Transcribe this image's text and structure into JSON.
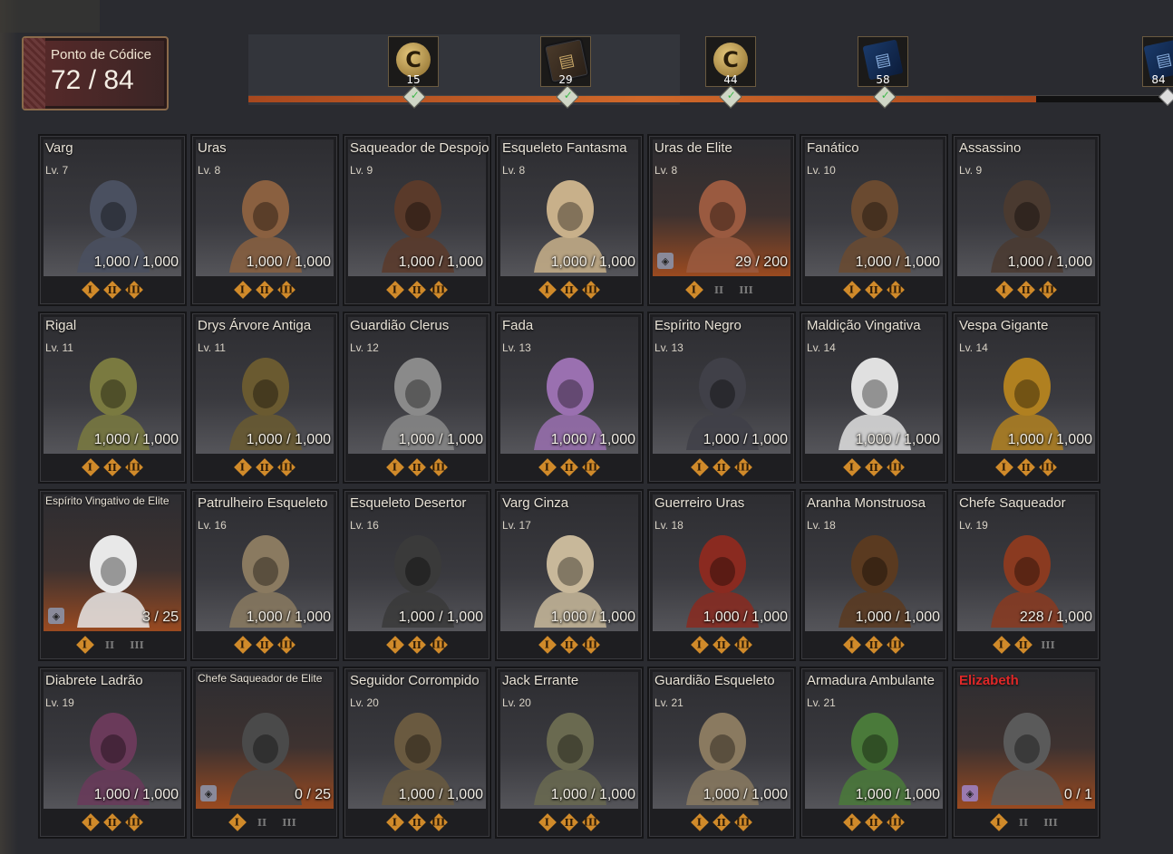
{
  "header": {
    "counter_label": "Ponto de Códice",
    "counter_value": "72 / 84",
    "progress_fraction": 0.86,
    "rewards": [
      {
        "icon": "coin-icon",
        "qty": "15"
      },
      {
        "icon": "card-icon",
        "qty": "29"
      },
      {
        "icon": "coin-icon",
        "qty": "44"
      },
      {
        "icon": "card-blue-icon",
        "qty": "58"
      },
      {
        "icon": "card-blue-icon",
        "qty": "84"
      }
    ]
  },
  "monsters": [
    {
      "name": "Varg",
      "level": "Lv. 7",
      "count": "1,000 / 1,000",
      "tiers": [
        1,
        1,
        1
      ]
    },
    {
      "name": "Uras",
      "level": "Lv. 8",
      "count": "1,000 / 1,000",
      "tiers": [
        1,
        1,
        1
      ]
    },
    {
      "name": "Saqueador de Despojos",
      "level": "Lv. 9",
      "count": "1,000 / 1,000",
      "tiers": [
        1,
        1,
        1
      ]
    },
    {
      "name": "Esqueleto Fantasma",
      "level": "Lv. 8",
      "count": "1,000 / 1,000",
      "tiers": [
        1,
        1,
        1
      ]
    },
    {
      "name": "Uras de Elite",
      "level": "Lv. 8",
      "count": "29 / 200",
      "tiers": [
        1,
        0,
        0
      ],
      "elite": true
    },
    {
      "name": "Fanático",
      "level": "Lv. 10",
      "count": "1,000 / 1,000",
      "tiers": [
        1,
        1,
        1
      ]
    },
    {
      "name": "Assassino",
      "level": "Lv. 9",
      "count": "1,000 / 1,000",
      "tiers": [
        1,
        1,
        1
      ]
    },
    {
      "name": "Rigal",
      "level": "Lv. 11",
      "count": "1,000 / 1,000",
      "tiers": [
        1,
        1,
        1
      ]
    },
    {
      "name": "Drys Árvore Antiga",
      "level": "Lv. 11",
      "count": "1,000 / 1,000",
      "tiers": [
        1,
        1,
        1
      ]
    },
    {
      "name": "Guardião Clerus",
      "level": "Lv. 12",
      "count": "1,000 / 1,000",
      "tiers": [
        1,
        1,
        1
      ]
    },
    {
      "name": "Fada",
      "level": "Lv. 13",
      "count": "1,000 / 1,000",
      "tiers": [
        1,
        1,
        1
      ]
    },
    {
      "name": "Espírito Negro",
      "level": "Lv. 13",
      "count": "1,000 / 1,000",
      "tiers": [
        1,
        1,
        1
      ]
    },
    {
      "name": "Maldição Vingativa",
      "level": "Lv. 14",
      "count": "1,000 / 1,000",
      "tiers": [
        1,
        1,
        1
      ]
    },
    {
      "name": "Vespa Gigante",
      "level": "Lv. 14",
      "count": "1,000 / 1,000",
      "tiers": [
        1,
        1,
        1
      ]
    },
    {
      "name": "Espírito Vingativo de Elite",
      "level": "",
      "count": "3 / 25",
      "tiers": [
        1,
        0,
        0
      ],
      "elite": true,
      "small": true
    },
    {
      "name": "Patrulheiro Esqueleto",
      "level": "Lv. 16",
      "count": "1,000 / 1,000",
      "tiers": [
        1,
        1,
        1
      ]
    },
    {
      "name": "Esqueleto Desertor",
      "level": "Lv. 16",
      "count": "1,000 / 1,000",
      "tiers": [
        1,
        1,
        1
      ]
    },
    {
      "name": "Varg Cinza",
      "level": "Lv. 17",
      "count": "1,000 / 1,000",
      "tiers": [
        1,
        1,
        1
      ]
    },
    {
      "name": "Guerreiro Uras",
      "level": "Lv. 18",
      "count": "1,000 / 1,000",
      "tiers": [
        1,
        1,
        1
      ]
    },
    {
      "name": "Aranha Monstruosa",
      "level": "Lv. 18",
      "count": "1,000 / 1,000",
      "tiers": [
        1,
        1,
        1
      ]
    },
    {
      "name": "Chefe Saqueador",
      "level": "Lv. 19",
      "count": "228 / 1,000",
      "tiers": [
        1,
        1,
        0
      ]
    },
    {
      "name": "Diabrete Ladrão",
      "level": "Lv. 19",
      "count": "1,000 / 1,000",
      "tiers": [
        1,
        1,
        1
      ]
    },
    {
      "name": "Chefe Saqueador de Elite",
      "level": "",
      "count": "0 / 25",
      "tiers": [
        1,
        0,
        0
      ],
      "elite": true,
      "small": true
    },
    {
      "name": "Seguidor Corrompido",
      "level": "Lv. 20",
      "count": "1,000 / 1,000",
      "tiers": [
        1,
        1,
        1
      ]
    },
    {
      "name": "Jack Errante",
      "level": "Lv. 20",
      "count": "1,000 / 1,000",
      "tiers": [
        1,
        1,
        1
      ]
    },
    {
      "name": "Guardião Esqueleto",
      "level": "Lv. 21",
      "count": "1,000 / 1,000",
      "tiers": [
        1,
        1,
        1
      ]
    },
    {
      "name": "Armadura Ambulante",
      "level": "Lv. 21",
      "count": "1,000 / 1,000",
      "tiers": [
        1,
        1,
        1
      ]
    },
    {
      "name": "Elizabeth",
      "level": "",
      "count": "0 / 1",
      "tiers": [
        1,
        0,
        0
      ],
      "elite": true,
      "boss": true
    }
  ],
  "tier_labels": [
    "I",
    "II",
    "III"
  ],
  "colors": {
    "accent": "#d08a2a",
    "progress": "#c0581f",
    "boss_name": "#e02828"
  }
}
